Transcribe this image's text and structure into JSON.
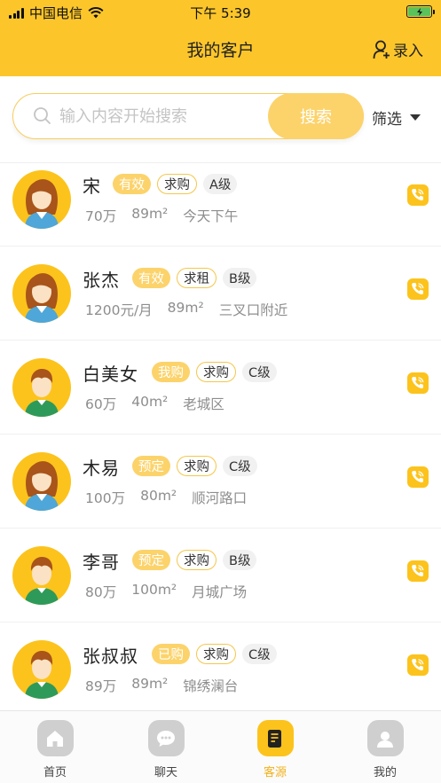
{
  "status_bar": {
    "carrier": "中国电信",
    "time": "下午 5:39"
  },
  "nav": {
    "title": "我的客户",
    "action_label": "录入"
  },
  "search": {
    "placeholder": "输入内容开始搜索",
    "button_label": "搜索",
    "filter_label": "筛选"
  },
  "customers": [
    {
      "name": "宋",
      "status": "有效",
      "type": "求购",
      "level": "A级",
      "price": "70万",
      "area": "89m²",
      "location": "今天下午",
      "gender": "female"
    },
    {
      "name": "张杰",
      "status": "有效",
      "type": "求租",
      "level": "B级",
      "price": "1200元/月",
      "area": "89m²",
      "location": "三叉口附近",
      "gender": "female"
    },
    {
      "name": "白美女",
      "status": "我购",
      "type": "求购",
      "level": "C级",
      "price": "60万",
      "area": "40m²",
      "location": "老城区",
      "gender": "male"
    },
    {
      "name": "木易",
      "status": "预定",
      "type": "求购",
      "level": "C级",
      "price": "100万",
      "area": "80m²",
      "location": "顺河路口",
      "gender": "female"
    },
    {
      "name": "李哥",
      "status": "预定",
      "type": "求购",
      "level": "B级",
      "price": "80万",
      "area": "100m²",
      "location": "月城广场",
      "gender": "male"
    },
    {
      "name": "张叔叔",
      "status": "已购",
      "type": "求购",
      "level": "C级",
      "price": "89万",
      "area": "89m²",
      "location": "锦绣澜台",
      "gender": "male"
    }
  ],
  "tabs": [
    {
      "label": "首页",
      "icon": "home-icon",
      "active": false
    },
    {
      "label": "聊天",
      "icon": "chat-icon",
      "active": false
    },
    {
      "label": "客源",
      "icon": "document-icon",
      "active": true
    },
    {
      "label": "我的",
      "icon": "person-icon",
      "active": false
    }
  ],
  "colors": {
    "brand": "#fcc62b",
    "tag_status": "#fcd36b",
    "active_tab": "#f3b11c"
  }
}
